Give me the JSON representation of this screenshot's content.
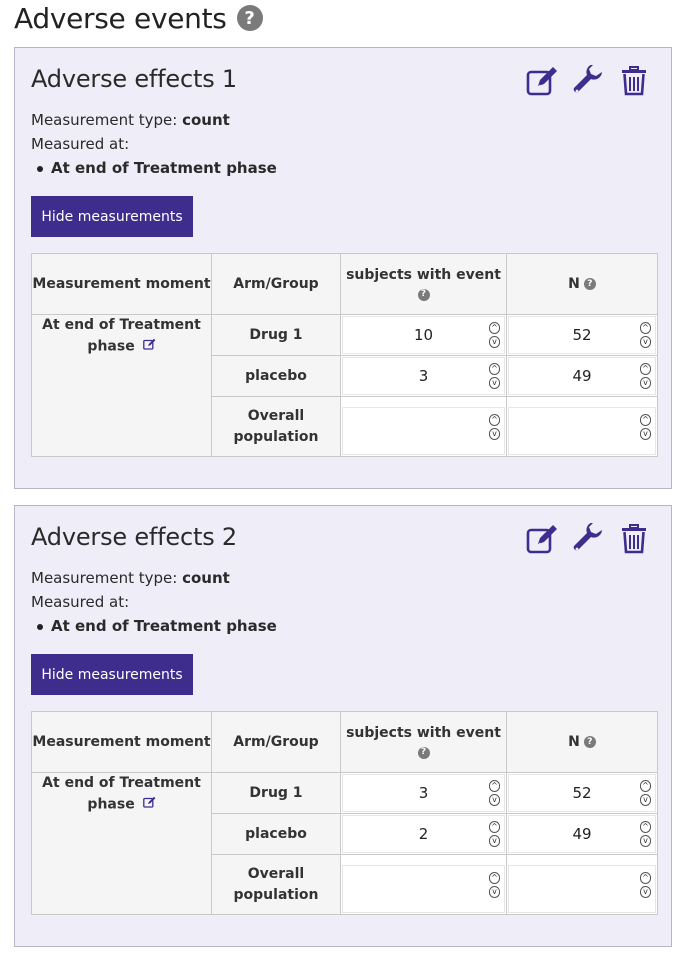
{
  "page": {
    "title": "Adverse events",
    "help_icon": "question-circle-icon"
  },
  "colors": {
    "accent": "#3f2d8e",
    "card_background": "#efedf8",
    "help_grey": "#7a7a7a"
  },
  "cards": [
    {
      "title": "Adverse effects 1",
      "measurement_type_label": "Measurement type:",
      "measurement_type_value": "count",
      "measured_at_label": "Measured at:",
      "measured_at_moment": "At end of Treatment phase",
      "hide_button_label": "Hide measurements",
      "toolbar_icons": [
        "edit-icon",
        "wrench-icon",
        "trash-icon"
      ],
      "table": {
        "headers": {
          "moment": "Measurement moment",
          "arm": "Arm/Group",
          "subjects": "subjects with event",
          "n": "N"
        },
        "moment_line1": "At end of Treatment",
        "moment_line2": "phase",
        "rows": [
          {
            "arm": "Drug 1",
            "subjects": "10",
            "n": "52"
          },
          {
            "arm": "placebo",
            "subjects": "3",
            "n": "49"
          }
        ],
        "overall_line1": "Overall",
        "overall_line2": "population",
        "overall_subjects": "",
        "overall_n": ""
      }
    },
    {
      "title": "Adverse effects 2",
      "measurement_type_label": "Measurement type:",
      "measurement_type_value": "count",
      "measured_at_label": "Measured at:",
      "measured_at_moment": "At end of Treatment phase",
      "hide_button_label": "Hide measurements",
      "toolbar_icons": [
        "edit-icon",
        "wrench-icon",
        "trash-icon"
      ],
      "table": {
        "headers": {
          "moment": "Measurement moment",
          "arm": "Arm/Group",
          "subjects": "subjects with event",
          "n": "N"
        },
        "moment_line1": "At end of Treatment",
        "moment_line2": "phase",
        "rows": [
          {
            "arm": "Drug 1",
            "subjects": "3",
            "n": "52"
          },
          {
            "arm": "placebo",
            "subjects": "2",
            "n": "49"
          }
        ],
        "overall_line1": "Overall",
        "overall_line2": "population",
        "overall_subjects": "",
        "overall_n": ""
      }
    }
  ]
}
